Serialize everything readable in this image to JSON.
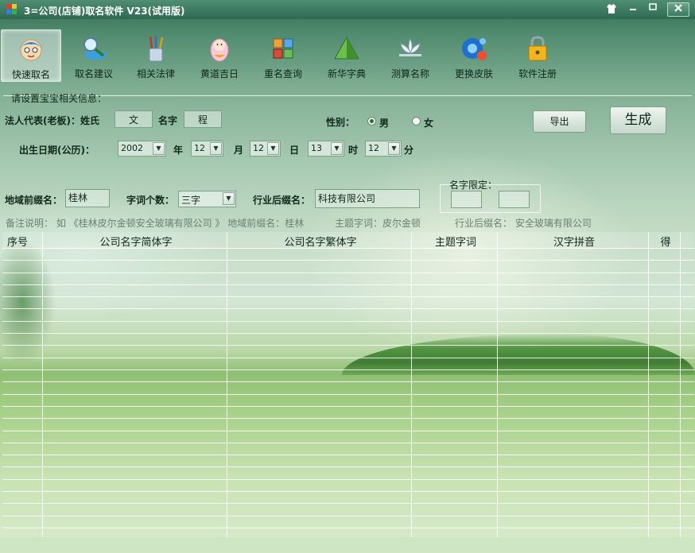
{
  "window": {
    "title": "3=公司(店铺)取名软件 V23(试用版)",
    "controls": [
      "shirt",
      "minimize",
      "maximize",
      "close"
    ]
  },
  "toolbar": {
    "items": [
      {
        "label": "快速取名",
        "icon": "baby-face-icon",
        "active": true
      },
      {
        "label": "取名建议",
        "icon": "magnifier-icon",
        "active": false
      },
      {
        "label": "相关法律",
        "icon": "pens-icon",
        "active": false
      },
      {
        "label": "黄道吉日",
        "icon": "baby-doll-icon",
        "active": false
      },
      {
        "label": "重名查询",
        "icon": "grid-tiles-icon",
        "active": false
      },
      {
        "label": "新华字典",
        "icon": "pyramid-icon",
        "active": false
      },
      {
        "label": "测算名称",
        "icon": "lotus-icon",
        "active": false
      },
      {
        "label": "更换皮肤",
        "icon": "bubbles-icon",
        "active": false
      },
      {
        "label": "软件注册",
        "icon": "padlock-icon",
        "active": false
      }
    ]
  },
  "form": {
    "group_title": "请设置宝宝相关信息：",
    "legal_rep_label": "法人代表(老板)：姓氏",
    "surname": "文",
    "given_label": "名字",
    "given": "程",
    "gender_label": "性别：",
    "gender_male": "男",
    "gender_female": "女",
    "export_label": "导出",
    "generate_label": "生成",
    "birth_label": "出生日期(公历)：",
    "year": "2002",
    "year_unit": "年",
    "month": "12",
    "month_unit": "月",
    "day": "12",
    "day_unit": "日",
    "hour": "13",
    "hour_unit": "时",
    "minute": "12",
    "minute_unit": "分",
    "region_label": "地域前缀名：",
    "region": "桂林",
    "wordcount_label": "字词个数：",
    "wordcount": "三字",
    "industry_label": "行业后缀名：",
    "industry": "科技有限公司",
    "name_limit_label": "名字限定：",
    "name_limit_1": "",
    "name_limit_2": ""
  },
  "notes": {
    "note1": "备注说明：  如 《桂林皮尔金顿安全玻璃有限公司 》  地域前缀名：桂林",
    "note2": "主题字词：皮尔金顿",
    "note3": "行业后缀名：  安全玻璃有限公司"
  },
  "table": {
    "columns": [
      "序号",
      "公司名字简体字",
      "公司名字繁体字",
      "主题字词",
      "汉字拼音",
      "得"
    ],
    "rows": []
  },
  "colors": {
    "accent": "#2e6a52",
    "grid_line": "#ffffff"
  }
}
